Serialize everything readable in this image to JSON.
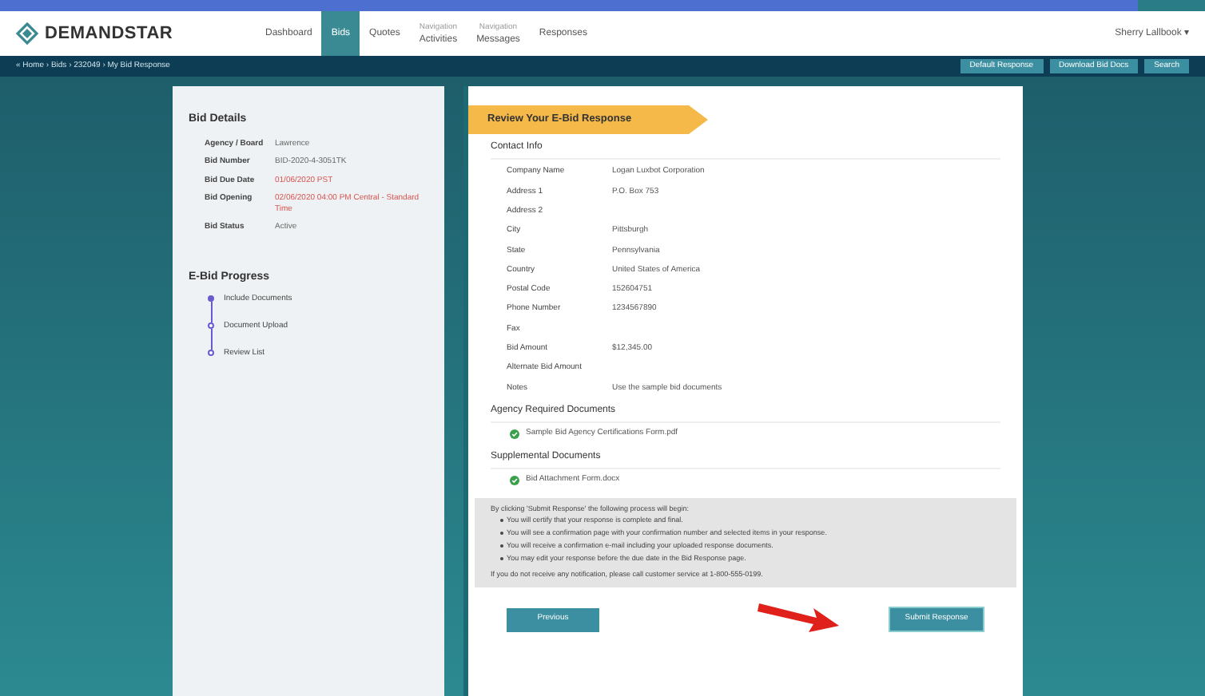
{
  "header": {
    "logo": "DEMANDSTAR",
    "nav": [
      {
        "label": "Dashboard",
        "selected": false
      },
      {
        "label": "Bids",
        "selected": true
      },
      {
        "label": "Quotes",
        "selected": false
      },
      {
        "label": "Activities",
        "sub": "Navigation",
        "selected": false
      },
      {
        "label": "Messages",
        "sub": "Navigation",
        "selected": false
      },
      {
        "label": "Responses",
        "selected": false
      }
    ],
    "user": "Sherry Lallbook ▾"
  },
  "toolbar": {
    "breadcrumb": "« Home › Bids › 232049 › My Bid Response",
    "buttons": [
      "Default Response",
      "Download Bid Docs",
      "Search"
    ]
  },
  "bid_details": {
    "title": "Bid Details",
    "rows": [
      {
        "label": "Agency / Board",
        "value": "Lawrence",
        "alert": false
      },
      {
        "label": "Bid Number",
        "value": "BID-2020-4-3051TK",
        "alert": false
      },
      {
        "label": "Bid Due Date",
        "value": "01/06/2020 PST",
        "alert": true
      },
      {
        "label": "Bid Opening",
        "value": "02/06/2020 04:00 PM Central - Standard Time",
        "alert": true
      },
      {
        "label": "Bid Status",
        "value": "Active",
        "alert": false
      }
    ]
  },
  "progress": {
    "title": "E-Bid Progress",
    "steps": [
      {
        "label": "Include Documents",
        "done": true
      },
      {
        "label": "Document Upload",
        "done": false
      },
      {
        "label": "Review List",
        "done": false
      }
    ]
  },
  "banner": "Review Your E-Bid Response",
  "contact": {
    "title": "Contact Info",
    "rows": [
      {
        "label": "Company Name",
        "value": "Logan Luxbot Corporation"
      },
      {
        "label": "Address 1",
        "value": "P.O. Box 753"
      },
      {
        "label": "Address 2"
      },
      {
        "label": "City",
        "value": "Pittsburgh"
      },
      {
        "label": "State",
        "value": "Pennsylvania"
      },
      {
        "label": "Country",
        "value": "United States of America"
      },
      {
        "label": "Postal Code",
        "value": "152604751"
      },
      {
        "label": "Phone Number",
        "value": "1234567890"
      },
      {
        "label": "Fax"
      },
      {
        "label": "Bid Amount",
        "value": "$12,345.00"
      },
      {
        "label": "Alternate Bid Amount"
      },
      {
        "label": "Notes",
        "value": "Use the sample bid documents"
      }
    ]
  },
  "required_documents": {
    "title": "Agency Required Documents",
    "items": [
      "Sample Bid Agency Certifications Form.pdf"
    ]
  },
  "supplemental_documents": {
    "title": "Supplemental Documents",
    "items": [
      "Bid Attachment Form.docx"
    ]
  },
  "notice": {
    "intro": "By clicking 'Submit Response' the following process will begin:",
    "bullets": [
      "You will certify that your response is complete and final.",
      "You will see a confirmation page with your confirmation number and selected items in your response.",
      "You will receive a confirmation e-mail including your uploaded response documents.",
      "You may edit your response before the due date in the Bid Response page."
    ],
    "footer": "If you do not receive any notification, please call customer service at 1-800-555-0199."
  },
  "buttons": {
    "previous": "Previous",
    "submit": "Submit Response"
  }
}
